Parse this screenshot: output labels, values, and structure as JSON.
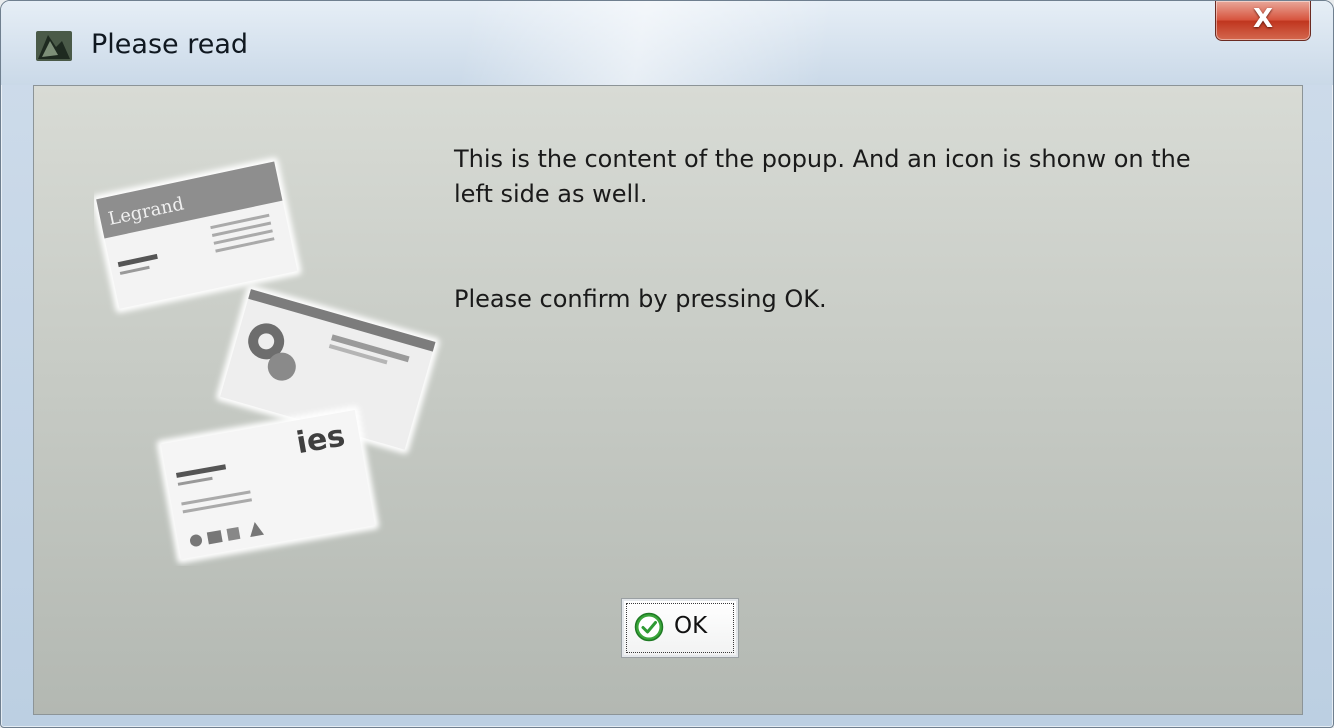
{
  "window": {
    "title": "Please read",
    "close_label": "X",
    "icons": {
      "app": "app-icon",
      "close": "close-icon",
      "illustration": "business-cards-illustration",
      "ok": "checkmark-icon"
    }
  },
  "message": {
    "line1": "This is the content of the popup. And an icon is shonw on the",
    "line2": "left side as well.",
    "confirm": "Please confirm by pressing OK."
  },
  "illustration_text": {
    "card1_brand": "Legrand",
    "card3_brand": "ies"
  },
  "buttons": {
    "ok_label": "OK"
  },
  "colors": {
    "close_button": "#c9452e",
    "ok_check": "#3aa53a"
  }
}
